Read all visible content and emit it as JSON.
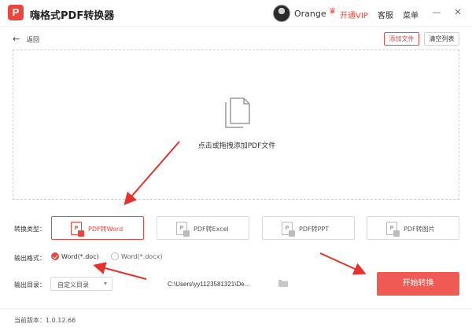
{
  "app": {
    "title": "嗨格式PDF转换器",
    "logo_letter": "P"
  },
  "header": {
    "username": "Orange",
    "vip_label": "开通VIP",
    "service_label": "客服",
    "menu_label": "菜单",
    "min_glyph": "—",
    "close_glyph": "✕"
  },
  "toolbar": {
    "back_label": "返回",
    "add_file_label": "添加文件",
    "clear_list_label": "清空列表"
  },
  "dropzone": {
    "hint": "点击或拖拽添加PDF文件"
  },
  "conversion": {
    "label": "转换类型：",
    "types": [
      {
        "label": "PDF转Word",
        "active": true
      },
      {
        "label": "PDF转Excel",
        "active": false
      },
      {
        "label": "PDF转PPT",
        "active": false
      },
      {
        "label": "PDF转图片",
        "active": false
      }
    ]
  },
  "output_format": {
    "label": "输出格式：",
    "options": [
      {
        "label": "Word(*.doc)",
        "checked": true
      },
      {
        "label": "Word(*.docx)",
        "checked": false
      }
    ]
  },
  "output_dir": {
    "label": "输出目录：",
    "select_value": "自定义目录",
    "path": "C:\\Users\\yy1123581321\\De..."
  },
  "start_button": "开始转换",
  "footer": {
    "version": "当前版本：1.0.12.66"
  },
  "colors": {
    "accent": "#e8463f",
    "start_button": "#f05a54"
  }
}
